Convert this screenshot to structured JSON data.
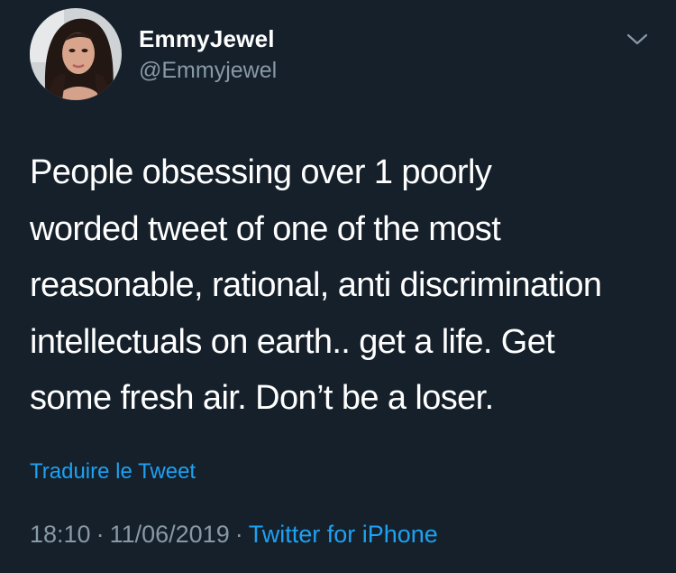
{
  "header": {
    "display_name": "EmmyJewel",
    "handle": "@Emmyjewel",
    "avatar_icon": "profile-photo",
    "menu_icon": "chevron-down-icon"
  },
  "tweet": {
    "text": "People obsessing over 1 poorly\nworded tweet of one of the most\nreasonable, rational, anti discrimination\nintellectuals on earth.. get a life. Get\nsome fresh air. Don’t be a loser.",
    "translate_label": "Traduire le Tweet",
    "time": "18:10",
    "date": "11/06/2019",
    "separator": "·",
    "source": "Twitter for iPhone"
  },
  "colors": {
    "background": "#15202b",
    "primary_text": "#ffffff",
    "secondary_text": "#8899a6",
    "accent": "#1da1f2"
  }
}
